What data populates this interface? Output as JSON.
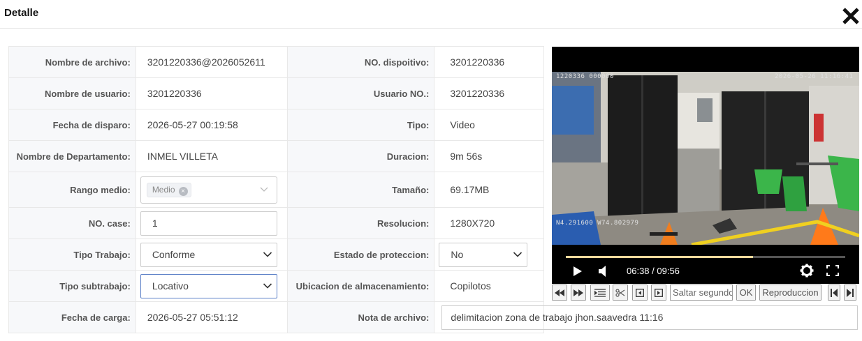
{
  "dialog": {
    "title": "Detalle"
  },
  "rows": [
    {
      "label1": "Nombre de archivo:",
      "value1": "3201220336@2026052611",
      "label2": "NO. dispoitivo:",
      "value2": "3201220336"
    },
    {
      "label1": "Nombre de usuario:",
      "value1": "3201220336",
      "label2": "Usuario NO.:",
      "value2": "3201220336"
    },
    {
      "label1": "Fecha de disparo:",
      "value1": "2026-05-27 00:19:58",
      "label2": "Tipo:",
      "value2": "Video"
    },
    {
      "label1": "Nombre de Departamento:",
      "value1": "INMEL VILLETA",
      "label2": "Duracion:",
      "value2": "9m 56s"
    },
    {
      "label1": "Rango medio:",
      "value1": "Medio",
      "label2": "Tamaño:",
      "value2": "69.17MB"
    },
    {
      "label1": "NO. case:",
      "value1": "1",
      "label2": "Resolucion:",
      "value2": "1280X720"
    },
    {
      "label1": "Tipo Trabajo:",
      "value1": "Conforme",
      "label2": "Estado de proteccion:",
      "value2": "No"
    },
    {
      "label1": "Tipo subtrabajo:",
      "value1": "Locativo",
      "label2": "Ubicacion de almacenamiento:",
      "value2": "Copilotos"
    },
    {
      "label1": "Fecha de carga:",
      "value1": "2026-05-27 05:51:12",
      "label2": "Nota de archivo:",
      "value2": "delimitacion zona de trabajo jhon.saavedra  11:16"
    }
  ],
  "video": {
    "osd_top_left": "1220336 000000",
    "osd_top_right": "2026-05-26  11:16:41",
    "osd_bottom_left": "N4.291600  W74.802979",
    "current_time": "06:38",
    "total_time": "09:56",
    "time_display": "06:38 / 09:56",
    "progress": 0.67
  },
  "toolbar": {
    "seek_placeholder": "Saltar segundos",
    "ok_label": "OK",
    "reproduccion_label": "Reproduccion"
  },
  "colors": {
    "progress_fill": "#ffd89b",
    "active_border": "#5b7fc7"
  },
  "icons": [
    "close-icon",
    "chevron-down-icon",
    "play-icon",
    "volume-icon",
    "gear-icon",
    "fullscreen-icon",
    "rewind-icon",
    "fast-forward-icon",
    "list-icon",
    "scissors-icon",
    "frame-back-icon",
    "frame-forward-icon",
    "skip-start-icon",
    "skip-end-icon"
  ]
}
